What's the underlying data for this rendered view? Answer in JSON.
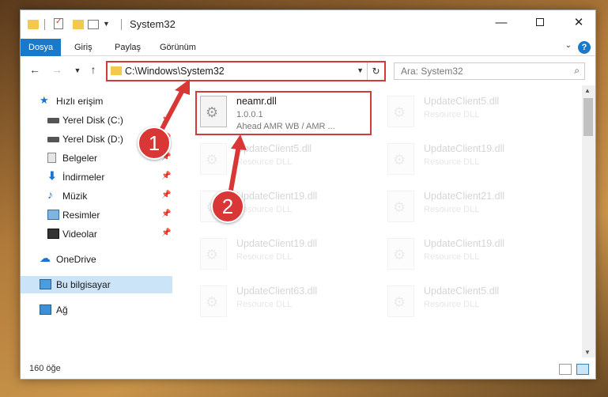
{
  "window": {
    "title": "System32"
  },
  "ribbon": {
    "tabs": [
      "Dosya",
      "Giriş",
      "Paylaş",
      "Görünüm"
    ]
  },
  "navbar": {
    "address": "C:\\Windows\\System32",
    "search_placeholder": "Ara: System32"
  },
  "sidebar": {
    "items": [
      {
        "label": "Hızlı erişim",
        "icon": "star-icon"
      },
      {
        "label": "Yerel Disk (C:)",
        "icon": "drive-icon",
        "pinned": true
      },
      {
        "label": "Yerel Disk (D:)",
        "icon": "drive-icon",
        "pinned": true
      },
      {
        "label": "Belgeler",
        "icon": "documents-icon",
        "pinned": true
      },
      {
        "label": "İndirmeler",
        "icon": "download-icon",
        "pinned": true
      },
      {
        "label": "Müzik",
        "icon": "music-icon",
        "pinned": true
      },
      {
        "label": "Resimler",
        "icon": "pictures-icon",
        "pinned": true
      },
      {
        "label": "Videolar",
        "icon": "videos-icon",
        "pinned": true
      },
      {
        "label": "OneDrive",
        "icon": "cloud-icon"
      },
      {
        "label": "Bu bilgisayar",
        "icon": "computer-icon",
        "selected": true
      },
      {
        "label": "Ağ",
        "icon": "network-icon"
      }
    ]
  },
  "files": [
    {
      "name": "neamr.dll",
      "version": "1.0.0.1",
      "desc": "Ahead AMR WB / AMR ..."
    },
    {
      "name": "UpdateClient5.dll",
      "version": "",
      "desc": "Resource DLL"
    },
    {
      "name": "UpdateClient5.dll",
      "version": "",
      "desc": "Resource DLL"
    },
    {
      "name": "UpdateClient19.dll",
      "version": "",
      "desc": "Resource DLL"
    },
    {
      "name": "UpdateClient19.dll",
      "version": "",
      "desc": "Resource DLL"
    },
    {
      "name": "UpdateClient21.dll",
      "version": "",
      "desc": "Resource DLL"
    },
    {
      "name": "UpdateClient19.dll",
      "version": "",
      "desc": "Resource DLL"
    },
    {
      "name": "UpdateClient19.dll",
      "version": "",
      "desc": "Resource DLL"
    },
    {
      "name": "UpdateClient63.dll",
      "version": "",
      "desc": "Resource DLL"
    },
    {
      "name": "UpdateClient5.dll",
      "version": "",
      "desc": "Resource DLL"
    }
  ],
  "status": {
    "count": "160 öğe"
  },
  "annotations": {
    "step1": "1",
    "step2": "2",
    "color": "#d93636"
  }
}
